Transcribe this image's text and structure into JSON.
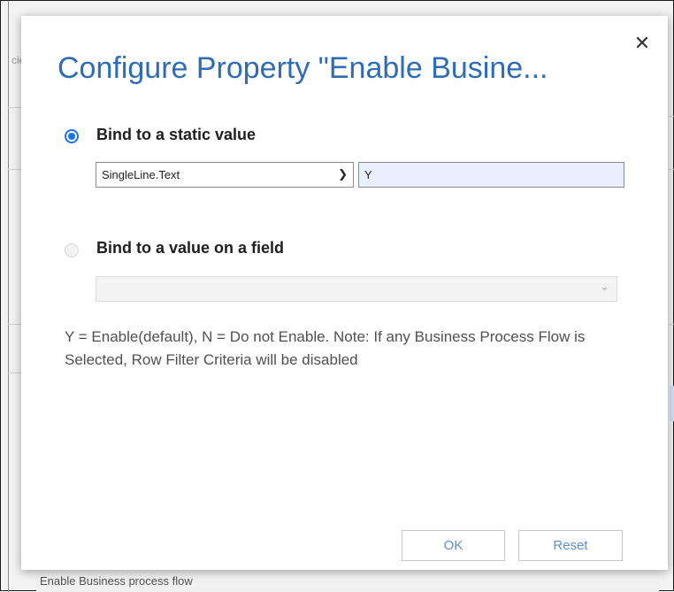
{
  "background": {
    "fragment_text": "cie",
    "bottom_label": "Enable Business process flow"
  },
  "dialog": {
    "title": "Configure Property \"Enable Busine...",
    "close_icon": "close-icon",
    "close_glyph": "✕",
    "options": [
      {
        "label": "Bind to a static value",
        "selected": true
      },
      {
        "label": "Bind to a value on a field",
        "selected": false
      }
    ],
    "static_value": {
      "type_select_value": "SingleLine.Text",
      "value": "Y"
    },
    "field_select": {
      "value": ""
    },
    "help_text": "Y = Enable(default), N = Do not Enable. Note: If any Business Process Flow is Selected, Row Filter Criteria will be disabled",
    "buttons": {
      "ok": "OK",
      "reset": "Reset"
    }
  },
  "colors": {
    "accent": "#1a73e8",
    "title": "#2e6db4",
    "button_text": "#5b8fd0",
    "input_bg": "#e8f0fe"
  }
}
